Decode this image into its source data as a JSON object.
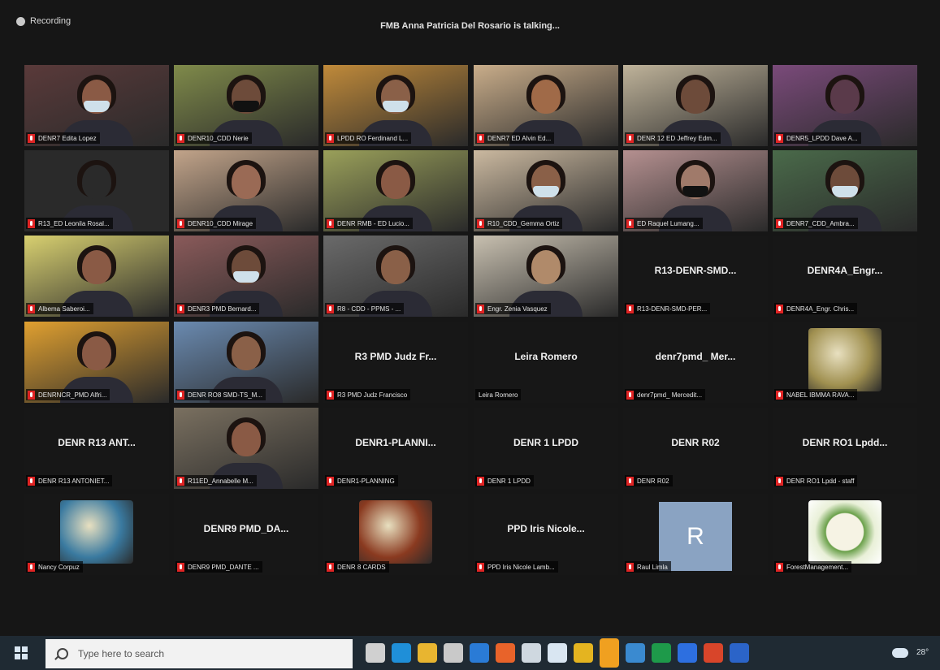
{
  "topbar": {
    "recording_label": "Recording",
    "speaking_banner": "FMB Anna Patricia Del Rosario is talking..."
  },
  "tiles": [
    {
      "kind": "video",
      "name": "DENR7 Edita Lopez",
      "scene": "#5a3a3a",
      "skin": "#8a5a45",
      "mask": "light"
    },
    {
      "kind": "video",
      "name": "DENR10_CDD Nerie",
      "scene": "#7f8a4a",
      "skin": "#6d4b3a",
      "mask": "black"
    },
    {
      "kind": "video",
      "name": "LPDD RO Ferdinand L...",
      "scene": "#c08a3a",
      "skin": "#8a6048",
      "mask": "light"
    },
    {
      "kind": "video",
      "name": "DENR7 ED Alvin Ed...",
      "scene": "#c9ad8a",
      "skin": "#a06a48",
      "mask": "none"
    },
    {
      "kind": "video",
      "name": "DENR 12 ED Jeffrey Edm...",
      "scene": "#bfb39a",
      "skin": "#6d4b3a",
      "mask": "none"
    },
    {
      "kind": "video",
      "name": "DENR5_LPDD Dave A...",
      "scene": "#7a4a7a",
      "skin": "#5a3a4a",
      "mask": "none"
    },
    {
      "kind": "video",
      "name": "R13_ED Leonila Rosal...",
      "scene": "#2a2a2a",
      "skin": "#2a2a2a",
      "mask": "none"
    },
    {
      "kind": "video",
      "name": "DENR10_CDD Mirage",
      "scene": "#c2a48a",
      "skin": "#9a6a55",
      "mask": "none"
    },
    {
      "kind": "video",
      "name": "DENR RMB - ED Lucio...",
      "scene": "#9aa05a",
      "skin": "#8a5a45",
      "mask": "none"
    },
    {
      "kind": "video",
      "name": "R10_CDD_Gemma Ortiz",
      "scene": "#cbb9a0",
      "skin": "#8a6048",
      "mask": "light"
    },
    {
      "kind": "video",
      "name": "ED Raquel Lumang...",
      "scene": "#b59090",
      "skin": "#a07a6a",
      "mask": "black"
    },
    {
      "kind": "video",
      "name": "DENR7_CDD_Ambra...",
      "scene": "#4a6a4a",
      "skin": "#6d4b3a",
      "mask": "light"
    },
    {
      "kind": "video",
      "name": "Albema Saberoi...",
      "scene": "#d8d070",
      "skin": "#8a5a45",
      "mask": "none"
    },
    {
      "kind": "video",
      "name": "DENR3 PMD Bernard...",
      "scene": "#8a5a5a",
      "skin": "#6d4b3a",
      "mask": "light"
    },
    {
      "kind": "video",
      "name": "R8 - CDD - PPMS - ...",
      "scene": "#6a6a6a",
      "skin": "#8a6048",
      "mask": "none"
    },
    {
      "kind": "video",
      "name": "Engr. Zenia Vasquez",
      "scene": "#c8c0b0",
      "skin": "#b08a6a",
      "mask": "none"
    },
    {
      "kind": "name",
      "center": "R13-DENR-SMD...",
      "name": "R13-DENR-SMD-PER..."
    },
    {
      "kind": "name",
      "center": "DENR4A_Engr...",
      "name": "DENR4A_Engr. Chris..."
    },
    {
      "kind": "video",
      "name": "DENRNCR_PMD Alfri...",
      "scene": "#e0a030",
      "skin": "#8a5a45",
      "mask": "none"
    },
    {
      "kind": "video",
      "name": "DENR RO8 SMD-TS_M...",
      "scene": "#6a8ab0",
      "skin": "#8a6048",
      "mask": "none"
    },
    {
      "kind": "name",
      "center": "R3 PMD Judz Fr...",
      "name": "R3 PMD Judz Francisco"
    },
    {
      "kind": "name",
      "center": "Leira Romero",
      "name": "Leira Romero",
      "nomic": true
    },
    {
      "kind": "name",
      "center": "denr7pmd_ Mer...",
      "name": "denr7pmd_ Mercedit..."
    },
    {
      "kind": "image",
      "name": "NABEL IBMMA RAVA...",
      "scene": "#a09050"
    },
    {
      "kind": "name",
      "center": "DENR R13 ANT...",
      "name": "DENR R13 ANTONIET..."
    },
    {
      "kind": "video",
      "name": "R11ED_Annabelle M...",
      "scene": "#7a7060",
      "skin": "#8a5a45",
      "mask": "none"
    },
    {
      "kind": "name",
      "center": "DENR1-PLANNI...",
      "name": "DENR1-PLANNING"
    },
    {
      "kind": "name",
      "center": "DENR 1 LPDD",
      "name": "DENR 1 LPDD"
    },
    {
      "kind": "name",
      "center": "DENR R02",
      "name": "DENR R02"
    },
    {
      "kind": "name",
      "center": "DENR RO1 Lpdd...",
      "name": "DENR RO1 Lpdd - staff"
    },
    {
      "kind": "image",
      "name": "Nancy Corpuz",
      "scene": "#3a7aa0"
    },
    {
      "kind": "name",
      "center": "DENR9 PMD_DA...",
      "name": "DENR9 PMD_DANTE ..."
    },
    {
      "kind": "image",
      "name": "DENR 8 CARDS",
      "scene": "#8a3a20"
    },
    {
      "kind": "name",
      "center": "PPD Iris Nicole...",
      "name": "PPD Iris Nicole Lamb..."
    },
    {
      "kind": "letter",
      "letter": "R",
      "name": "Raul Limla"
    },
    {
      "kind": "logo",
      "name": "ForestManagement...",
      "scene": "#6aa04a"
    }
  ],
  "taskbar": {
    "search_placeholder": "Type here to search",
    "tray_time": "28°",
    "apps": [
      "task-view-icon",
      "edge-icon",
      "file-explorer-icon",
      "store-icon",
      "mail-icon",
      "firefox-icon",
      "notepad-icon",
      "dropbox-icon",
      "chrome-icon",
      "sticky-notes-icon",
      "photos-icon",
      "excel-icon",
      "zoom-icon",
      "powerpoint-icon",
      "word-icon"
    ],
    "app_colors": [
      "#d0d0d0",
      "#1f8fd8",
      "#e8b530",
      "#c9c9c9",
      "#2a7bd6",
      "#e8632a",
      "#cfd8e0",
      "#d9e6f2",
      "#e4b420",
      "#f0a020",
      "#3a8ad0",
      "#1e9a4a",
      "#2d6fe0",
      "#d8452a",
      "#2b64c8"
    ]
  }
}
